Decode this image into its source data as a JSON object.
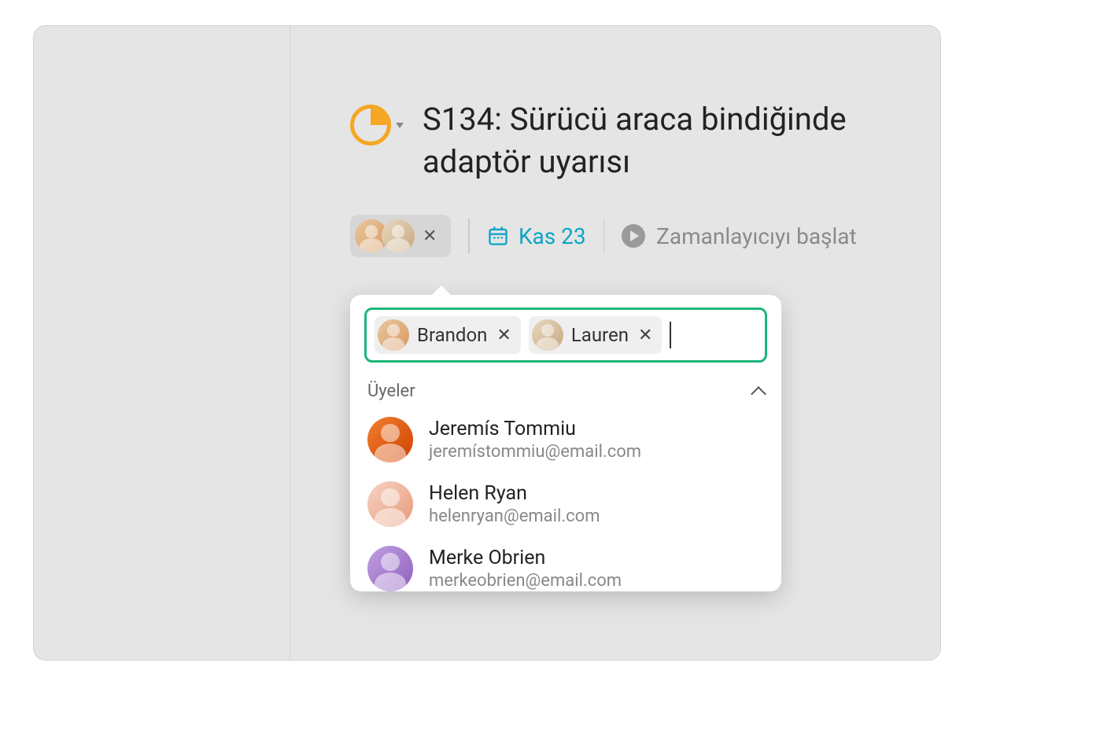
{
  "task": {
    "title": "S134: Sürücü araca bindiğinde adaptör uyarısı",
    "date_label": "Kas 23",
    "timer_label": "Zamanlayıcıyı başlat"
  },
  "selected_assignees": [
    {
      "name": "Brandon"
    },
    {
      "name": "Lauren"
    }
  ],
  "dropdown": {
    "section_label": "Üyeler",
    "members": [
      {
        "name": "Jeremís Tommiu",
        "email": "jeremístommiu@email.com"
      },
      {
        "name": "Helen Ryan",
        "email": "helenryan@email.com"
      },
      {
        "name": "Merke Obrien",
        "email": "merkeobrien@email.com"
      }
    ]
  }
}
